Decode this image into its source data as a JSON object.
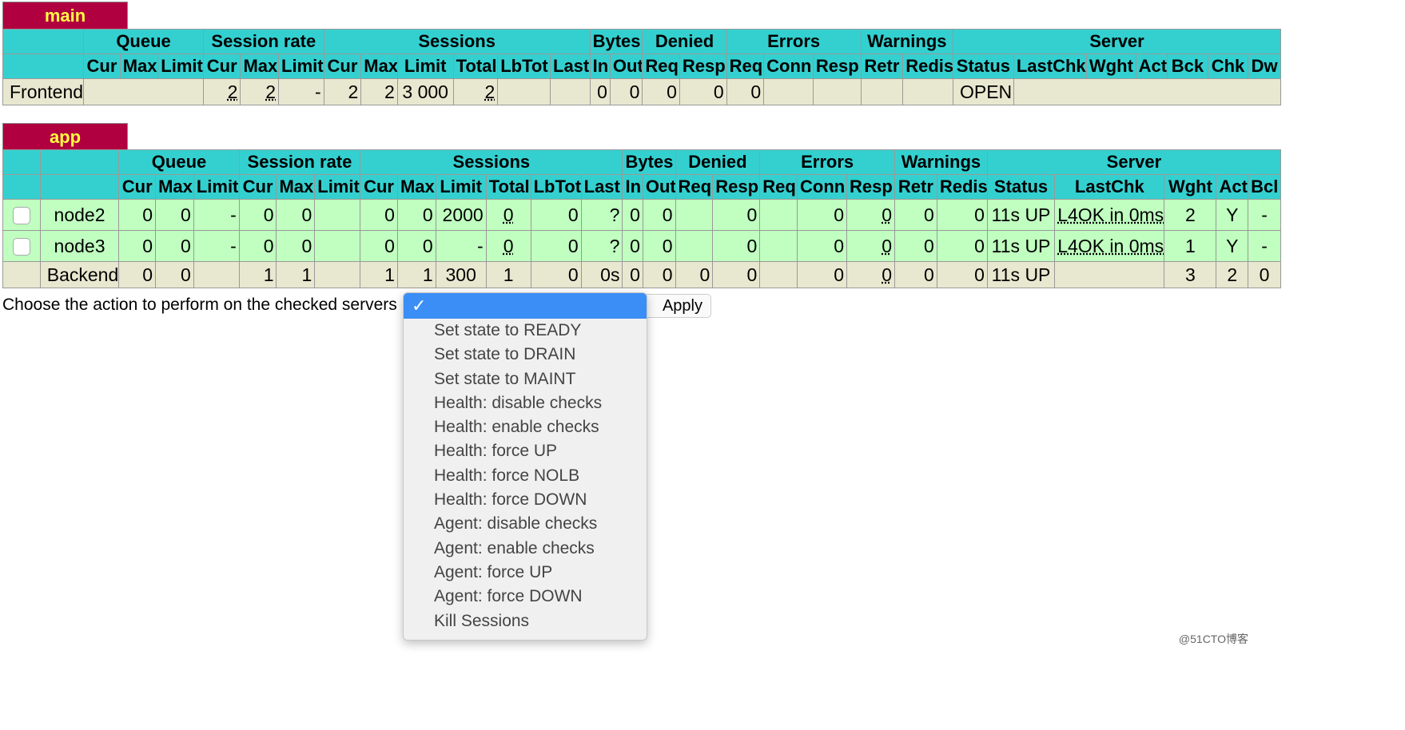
{
  "main": {
    "title": "main",
    "group_headers": [
      "Queue",
      "Session rate",
      "Sessions",
      "Bytes",
      "Denied",
      "Errors",
      "Warnings",
      "Server"
    ],
    "sub_headers": [
      "Cur",
      "Max",
      "Limit",
      "Cur",
      "Max",
      "Limit",
      "Cur",
      "Max",
      "Limit",
      "Total",
      "LbTot",
      "Last",
      "In",
      "Out",
      "Req",
      "Resp",
      "Req",
      "Conn",
      "Resp",
      "Retr",
      "Redis",
      "Status",
      "LastChk",
      "Wght",
      "Act",
      "Bck",
      "Chk",
      "Dw"
    ],
    "frontend": {
      "name": "Frontend",
      "rate_cur": "2",
      "rate_max": "2",
      "rate_limit": "-",
      "sess_cur": "2",
      "sess_max": "2",
      "sess_limit": "3 000",
      "sess_total": "2",
      "bytes_in": "0",
      "bytes_out": "0",
      "denied_req": "0",
      "denied_resp": "0",
      "err_req": "0",
      "status": "OPEN"
    }
  },
  "app": {
    "title": "app",
    "group_headers": [
      "Queue",
      "Session rate",
      "Sessions",
      "Bytes",
      "Denied",
      "Errors",
      "Warnings",
      "Server"
    ],
    "sub_headers": [
      "Cur",
      "Max",
      "Limit",
      "Cur",
      "Max",
      "Limit",
      "Cur",
      "Max",
      "Limit",
      "Total",
      "LbTot",
      "Last",
      "In",
      "Out",
      "Req",
      "Resp",
      "Req",
      "Conn",
      "Resp",
      "Retr",
      "Redis",
      "Status",
      "LastChk",
      "Wght",
      "Act",
      "Bcl"
    ],
    "rows": [
      {
        "name": "node2",
        "q_cur": "0",
        "q_max": "0",
        "q_limit": "-",
        "r_cur": "0",
        "r_max": "0",
        "r_limit": "",
        "s_cur": "0",
        "s_max": "0",
        "s_limit": "2000",
        "s_total": "0",
        "s_lbtot": "0",
        "s_last": "?",
        "b_in": "0",
        "b_out": "0",
        "d_req": "",
        "d_resp": "0",
        "e_req": "",
        "e_conn": "0",
        "e_resp": "0",
        "w_retr": "0",
        "w_redis": "0",
        "status": "11s UP",
        "lastchk": "L4OK in 0ms",
        "wght": "2",
        "act": "Y",
        "bck": "-"
      },
      {
        "name": "node3",
        "q_cur": "0",
        "q_max": "0",
        "q_limit": "-",
        "r_cur": "0",
        "r_max": "0",
        "r_limit": "",
        "s_cur": "0",
        "s_max": "0",
        "s_limit": "-",
        "s_total": "0",
        "s_lbtot": "0",
        "s_last": "?",
        "b_in": "0",
        "b_out": "0",
        "d_req": "",
        "d_resp": "0",
        "e_req": "",
        "e_conn": "0",
        "e_resp": "0",
        "w_retr": "0",
        "w_redis": "0",
        "status": "11s UP",
        "lastchk": "L4OK in 0ms",
        "wght": "1",
        "act": "Y",
        "bck": "-"
      }
    ],
    "backend": {
      "name": "Backend",
      "q_cur": "0",
      "q_max": "0",
      "q_limit": "",
      "r_cur": "1",
      "r_max": "1",
      "r_limit": "",
      "s_cur": "1",
      "s_max": "1",
      "s_limit": "300",
      "s_total": "1",
      "s_lbtot": "0",
      "s_last": "0s",
      "b_in": "0",
      "b_out": "0",
      "d_req": "0",
      "d_resp": "0",
      "e_req": "",
      "e_conn": "0",
      "e_resp": "0",
      "w_retr": "0",
      "w_redis": "0",
      "status": "11s UP",
      "lastchk": "",
      "wght": "3",
      "act": "2",
      "bck": "0"
    }
  },
  "action": {
    "label": "Choose the action to perform on the checked servers :",
    "selected_glyph": "✓",
    "options": [
      "Set state to READY",
      "Set state to DRAIN",
      "Set state to MAINT",
      "Health: disable checks",
      "Health: enable checks",
      "Health: force UP",
      "Health: force NOLB",
      "Health: force DOWN",
      "Agent: disable checks",
      "Agent: enable checks",
      "Agent: force UP",
      "Agent: force DOWN",
      "Kill Sessions"
    ],
    "apply_label": "Apply"
  },
  "watermark": "@51CTO博客",
  "colors": {
    "title_bg": "#b00040",
    "title_fg": "#ffff40",
    "header_bg": "#34d0d0",
    "up_row": "#c0ffc0",
    "neutral_row": "#e8e8d0",
    "dropdown_selected": "#3b8ef5"
  }
}
